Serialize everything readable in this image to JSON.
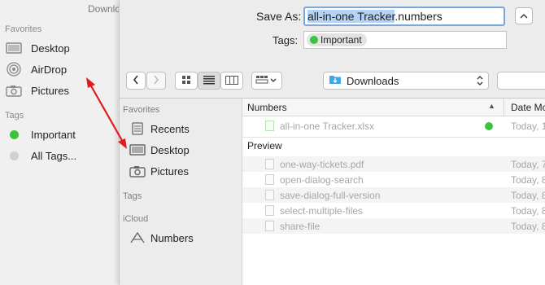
{
  "background_window": {
    "title": "Downlo",
    "favorites_header": "Favorites",
    "favorites": [
      {
        "label": "Desktop",
        "icon": "desktop-icon"
      },
      {
        "label": "AirDrop",
        "icon": "airdrop-icon"
      },
      {
        "label": "Pictures",
        "icon": "camera-icon"
      }
    ],
    "tags_header": "Tags",
    "tags": [
      {
        "label": "Important",
        "color": "#3bc43b"
      },
      {
        "label": "All Tags...",
        "color": "#d0d0d0"
      }
    ]
  },
  "dialog": {
    "save_as_label": "Save As:",
    "filename_selected": "all-in-one Tracker",
    "filename_ext": ".numbers",
    "tags_label": "Tags:",
    "tag_pill": {
      "label": "Important",
      "color": "#3bc43b"
    },
    "location": "Downloads",
    "toolbar_icons": [
      "chevron-left-icon",
      "chevron-right-icon",
      "icon-view-icon",
      "list-view-icon",
      "column-view-icon",
      "group-menu-icon"
    ]
  },
  "sidebar": {
    "favorites_header": "Favorites",
    "favorites": [
      {
        "label": "Recents",
        "icon": "recents-icon"
      },
      {
        "label": "Desktop",
        "icon": "desktop-icon"
      },
      {
        "label": "Pictures",
        "icon": "camera-icon"
      }
    ],
    "tags_header": "Tags",
    "icloud_header": "iCloud",
    "icloud": [
      {
        "label": "Numbers",
        "icon": "numbers-app-icon"
      }
    ]
  },
  "file_list": {
    "columns": {
      "name": "Numbers",
      "date": "Date Mo"
    },
    "numbers_files": [
      {
        "name": "all-in-one Tracker.xlsx",
        "date": "Today, 1",
        "tag_color": "#3bc43b"
      }
    ],
    "preview_header": "Preview",
    "preview_files": [
      {
        "name": "one-way-tickets.pdf",
        "date": "Today, 7"
      },
      {
        "name": "open-dialog-search",
        "date": "Today, 8"
      },
      {
        "name": "save-dialog-full-version",
        "date": "Today, 8"
      },
      {
        "name": "select-multiple-files",
        "date": "Today, 8"
      },
      {
        "name": "share-file",
        "date": "Today, 8"
      }
    ]
  },
  "colors": {
    "accent": "#7aa7e0",
    "selection": "#b5d2f7",
    "tag_green": "#3bc43b",
    "arrow": "#e01b1b",
    "folder_blue": "#3fa6e8"
  }
}
